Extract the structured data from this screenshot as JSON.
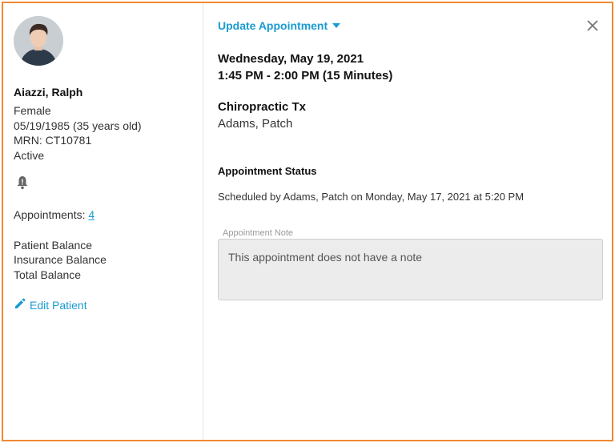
{
  "patient": {
    "name": "Aiazzi, Ralph",
    "gender": "Female",
    "dob": "05/19/1985 (35 years old)",
    "mrn": "MRN: CT10781",
    "status": "Active",
    "appointments_label": "Appointments: ",
    "appointments_count": "4",
    "patient_balance": "Patient Balance",
    "insurance_balance": "Insurance Balance",
    "total_balance": "Total Balance",
    "edit_label": "Edit Patient"
  },
  "appointment": {
    "update_label": "Update Appointment",
    "date": "Wednesday, May 19, 2021",
    "time": "1:45 PM - 2:00 PM (15 Minutes)",
    "service": "Chiropractic Tx",
    "provider": "Adams, Patch",
    "status_title": "Appointment Status",
    "status_text": "Scheduled by Adams, Patch on Monday, May 17, 2021 at 5:20 PM",
    "note_label": "Appointment Note",
    "note_text": "This appointment does not have a note"
  },
  "icons": {
    "bell": "bell-icon",
    "pencil": "pencil-icon",
    "close": "close-icon",
    "caret": "caret-down-icon"
  },
  "colors": {
    "accent": "#1b9bd1",
    "frame_border": "#f08a33"
  }
}
